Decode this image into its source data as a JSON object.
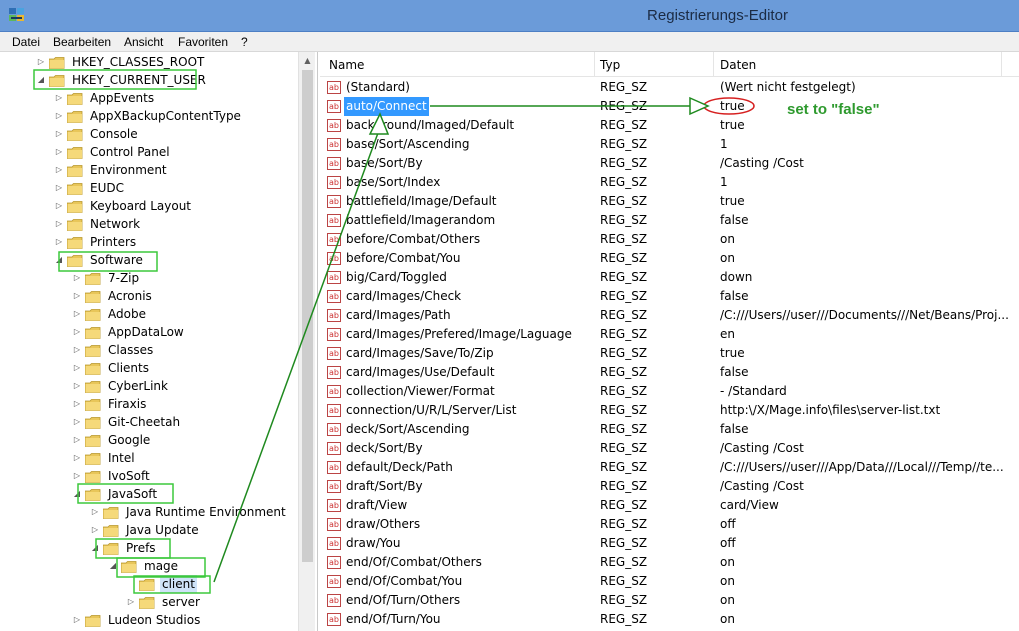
{
  "window": {
    "title": "Registrierungs-Editor",
    "icon": "regedit-icon"
  },
  "menu": [
    "Datei",
    "Bearbeiten",
    "Ansicht",
    "Favoriten",
    "?"
  ],
  "tree": [
    {
      "label": "HKEY_CLASSES_ROOT",
      "depth": 0,
      "expanded": false
    },
    {
      "label": "HKEY_CURRENT_USER",
      "depth": 0,
      "expanded": true,
      "highlighted": true
    },
    {
      "label": "AppEvents",
      "depth": 1,
      "expanded": false
    },
    {
      "label": "AppXBackupContentType",
      "depth": 1,
      "expanded": false
    },
    {
      "label": "Console",
      "depth": 1,
      "expanded": false
    },
    {
      "label": "Control Panel",
      "depth": 1,
      "expanded": false
    },
    {
      "label": "Environment",
      "depth": 1,
      "expanded": false
    },
    {
      "label": "EUDC",
      "depth": 1,
      "expanded": false
    },
    {
      "label": "Keyboard Layout",
      "depth": 1,
      "expanded": false
    },
    {
      "label": "Network",
      "depth": 1,
      "expanded": false
    },
    {
      "label": "Printers",
      "depth": 1,
      "expanded": false
    },
    {
      "label": "Software",
      "depth": 1,
      "expanded": true,
      "highlighted": true
    },
    {
      "label": "7-Zip",
      "depth": 2,
      "expanded": false
    },
    {
      "label": "Acronis",
      "depth": 2,
      "expanded": false
    },
    {
      "label": "Adobe",
      "depth": 2,
      "expanded": false
    },
    {
      "label": "AppDataLow",
      "depth": 2,
      "expanded": false
    },
    {
      "label": "Classes",
      "depth": 2,
      "expanded": false
    },
    {
      "label": "Clients",
      "depth": 2,
      "expanded": false
    },
    {
      "label": "CyberLink",
      "depth": 2,
      "expanded": false
    },
    {
      "label": "Firaxis",
      "depth": 2,
      "expanded": false
    },
    {
      "label": "Git-Cheetah",
      "depth": 2,
      "expanded": false
    },
    {
      "label": "Google",
      "depth": 2,
      "expanded": false
    },
    {
      "label": "Intel",
      "depth": 2,
      "expanded": false
    },
    {
      "label": "IvoSoft",
      "depth": 2,
      "expanded": false
    },
    {
      "label": "JavaSoft",
      "depth": 2,
      "expanded": true,
      "highlighted": true
    },
    {
      "label": "Java Runtime Environment",
      "depth": 3,
      "expanded": false
    },
    {
      "label": "Java Update",
      "depth": 3,
      "expanded": false
    },
    {
      "label": "Prefs",
      "depth": 3,
      "expanded": true,
      "highlighted": true
    },
    {
      "label": "mage",
      "depth": 4,
      "expanded": true,
      "highlighted": true
    },
    {
      "label": "client",
      "depth": 5,
      "leaf": true,
      "highlighted": true,
      "selected": true
    },
    {
      "label": "server",
      "depth": 5,
      "expanded": false
    },
    {
      "label": "Ludeon Studios",
      "depth": 2,
      "expanded": false
    }
  ],
  "columns": {
    "name": "Name",
    "type": "Typ",
    "data": "Daten"
  },
  "values": [
    {
      "name": "(Standard)",
      "type": "REG_SZ",
      "data": "(Wert nicht festgelegt)"
    },
    {
      "name": "auto/Connect",
      "type": "REG_SZ",
      "data": "true",
      "selected": true
    },
    {
      "name": "background/Imaged/Default",
      "type": "REG_SZ",
      "data": "true"
    },
    {
      "name": "base/Sort/Ascending",
      "type": "REG_SZ",
      "data": "1"
    },
    {
      "name": "base/Sort/By",
      "type": "REG_SZ",
      "data": "/Casting /Cost"
    },
    {
      "name": "base/Sort/Index",
      "type": "REG_SZ",
      "data": "1"
    },
    {
      "name": "battlefield/Image/Default",
      "type": "REG_SZ",
      "data": "true"
    },
    {
      "name": "battlefield/Imagerandom",
      "type": "REG_SZ",
      "data": "false"
    },
    {
      "name": "before/Combat/Others",
      "type": "REG_SZ",
      "data": "on"
    },
    {
      "name": "before/Combat/You",
      "type": "REG_SZ",
      "data": "on"
    },
    {
      "name": "big/Card/Toggled",
      "type": "REG_SZ",
      "data": "down"
    },
    {
      "name": "card/Images/Check",
      "type": "REG_SZ",
      "data": "false"
    },
    {
      "name": "card/Images/Path",
      "type": "REG_SZ",
      "data": "/C:///Users//user///Documents///Net/Beans/Proj..."
    },
    {
      "name": "card/Images/Prefered/Image/Laguage",
      "type": "REG_SZ",
      "data": "en"
    },
    {
      "name": "card/Images/Save/To/Zip",
      "type": "REG_SZ",
      "data": "true"
    },
    {
      "name": "card/Images/Use/Default",
      "type": "REG_SZ",
      "data": "false"
    },
    {
      "name": "collection/Viewer/Format",
      "type": "REG_SZ",
      "data": "- /Standard"
    },
    {
      "name": "connection/U/R/L/Server/List",
      "type": "REG_SZ",
      "data": "http:\\/X/Mage.info\\files\\server-list.txt"
    },
    {
      "name": "deck/Sort/Ascending",
      "type": "REG_SZ",
      "data": "false"
    },
    {
      "name": "deck/Sort/By",
      "type": "REG_SZ",
      "data": "/Casting /Cost"
    },
    {
      "name": "default/Deck/Path",
      "type": "REG_SZ",
      "data": "/C:///Users//user///App/Data///Local///Temp//te..."
    },
    {
      "name": "draft/Sort/By",
      "type": "REG_SZ",
      "data": "/Casting /Cost"
    },
    {
      "name": "draft/View",
      "type": "REG_SZ",
      "data": "card/View"
    },
    {
      "name": "draw/Others",
      "type": "REG_SZ",
      "data": "off"
    },
    {
      "name": "draw/You",
      "type": "REG_SZ",
      "data": "off"
    },
    {
      "name": "end/Of/Combat/Others",
      "type": "REG_SZ",
      "data": "on"
    },
    {
      "name": "end/Of/Combat/You",
      "type": "REG_SZ",
      "data": "on"
    },
    {
      "name": "end/Of/Turn/Others",
      "type": "REG_SZ",
      "data": "on"
    },
    {
      "name": "end/Of/Turn/You",
      "type": "REG_SZ",
      "data": "on"
    }
  ],
  "annotation": {
    "text": "set to \"false\"",
    "color": "#2e9a2e",
    "circle_color": "#d62020",
    "line_color": "#1f8a1f"
  },
  "value_icon": "string-value-icon",
  "folder_icon": "folder-icon"
}
